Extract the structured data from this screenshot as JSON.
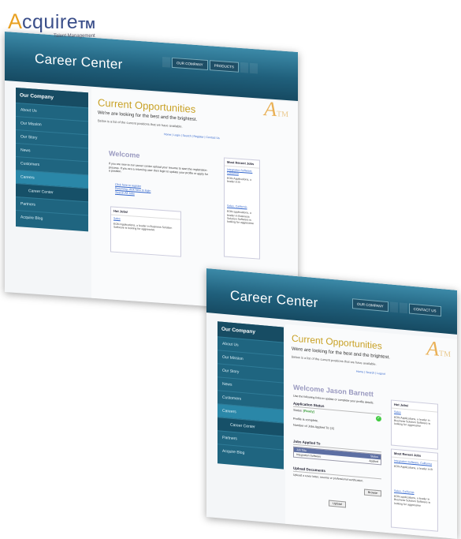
{
  "logo": {
    "a": "A",
    "rest": "cquire",
    "tm": "TM",
    "subtitle": "Talent Management"
  },
  "shot1": {
    "banner_title": "Career Center",
    "nav": [
      "",
      "OUR COMPANY",
      "PRODUCTS",
      "",
      ""
    ],
    "atm": "A",
    "atm_tm": "TM",
    "sidebar": {
      "head": "Our Company",
      "items": [
        "About Us",
        "Our Mission",
        "Our Story",
        "News",
        "Customers",
        "Careers",
        "Career Center",
        "Partners",
        "Acquire Blog"
      ]
    },
    "title": "Current Opportunities",
    "tagline": "We're are looking for the best and the brightest.",
    "desc": "Below is a list of the current positions that we have available.",
    "crumbs": "Home | Login | Search | Register | Contact Us",
    "welcome": "Welcome",
    "welcome_text": "If you are new to our career center upload your resume to start the registration process. If you are a returning user then login to update your profile or apply for a position.",
    "links": [
      "Click here to register",
      "Returning, click here to login",
      "Search All Jobs"
    ],
    "hot_jobs": {
      "head": "Hot Jobs!",
      "link": "Sales",
      "text": "EON Applications, a leader in Business Solution Software is looking for aggressive"
    },
    "recent": {
      "head": "Most Recent Jobs",
      "link1": "Integration Software, California",
      "text1": "EON Applications, a leader in B",
      "link2": "Sales, California",
      "text2": "EON applications, a leader in Business Solution Software is looking for aggressive"
    },
    "bottom_link": "RSS Feed"
  },
  "shot2": {
    "banner_title": "Career Center",
    "nav": [
      "OUR COMPANY",
      "",
      "",
      "CONTACT US"
    ],
    "atm": "A",
    "atm_tm": "TM",
    "sidebar": {
      "head": "Our Company",
      "items": [
        "About Us",
        "Our Mission",
        "Our Story",
        "News",
        "Customers",
        "Careers",
        "Career Center",
        "Partners",
        "Acquire Blog"
      ]
    },
    "title": "Current Opportunities",
    "tagline": "Were are looking for the best and the brightest.",
    "desc": "Below is a list of the current positions that we have available.",
    "crumbs": "Home | Search | Logout",
    "welcome": "Welcome Jason Barnett",
    "welcome_text": "Use the following links to update or complete your profile details.",
    "status": {
      "head": "Application Status",
      "status_label": "Status:",
      "status_value": "[Ready]",
      "profile": "Profile is complete.",
      "applied": "Number of Jobs Applied To: [4]",
      "check": "✓"
    },
    "jobs": {
      "head": "Jobs Applied To",
      "col1": "Job Title",
      "col2": "Status",
      "row_title": "Integration Software",
      "row_status": "Applied"
    },
    "upload": {
      "head": "Upload Documents",
      "text": "Upload a cover letter, resume or professional certification.",
      "browse": "Browse",
      "button": "Upload"
    },
    "hot_jobs": {
      "head": "Hot Jobs!",
      "link": "Sales",
      "text": "EON Applications, a leader in Business Solution Software is looking for aggressive"
    },
    "recent": {
      "head": "Most Recent Jobs",
      "link1": "Integration Software, California",
      "text1": "EON Applications, a leader in B",
      "link2": "Sales, California",
      "text2": "EON applications, a leader in Business Solution Software is looking for aggressive"
    }
  }
}
